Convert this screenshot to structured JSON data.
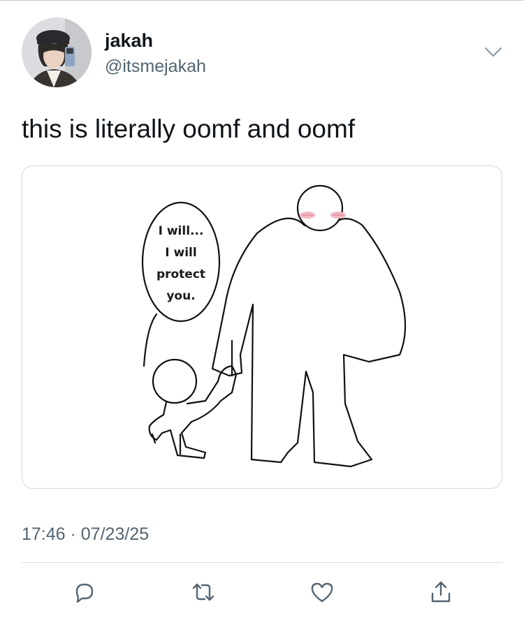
{
  "author": {
    "display_name": "jakah",
    "username": "@itsmejakah"
  },
  "tweet": {
    "text": "this is literally oomf and oomf",
    "time": "17:46",
    "date": "07/23/25",
    "timestamp_separator": " · "
  },
  "media": {
    "bubble_lines": [
      "I will...",
      "I will",
      "protect",
      "you."
    ]
  },
  "icons": {
    "more": "chevron-down-icon",
    "reply": "reply-icon",
    "retweet": "retweet-icon",
    "like": "heart-icon",
    "share": "share-icon"
  },
  "colors": {
    "text_primary": "#0f1419",
    "text_secondary": "#536471",
    "border": "#cfd9de",
    "icon": "#536471",
    "blush": "#f4b6c2"
  }
}
